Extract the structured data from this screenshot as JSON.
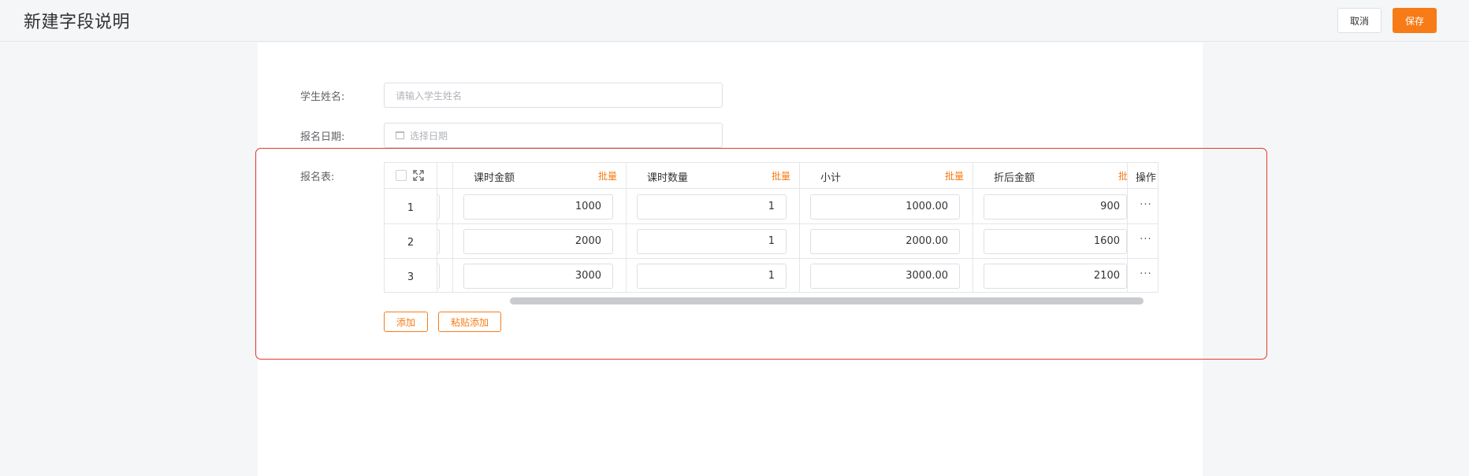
{
  "header": {
    "title": "新建字段说明",
    "cancel_label": "取消",
    "save_label": "保存"
  },
  "form": {
    "student_name": {
      "label": "学生姓名:",
      "placeholder": "请输入学生姓名",
      "value": ""
    },
    "enroll_date": {
      "label": "报名日期:",
      "placeholder": "选择日期",
      "value": ""
    },
    "enroll_table": {
      "label": "报名表:",
      "batch_label": "批量",
      "columns": [
        "课时金额",
        "课时数量",
        "小计",
        "折后金额"
      ],
      "action_header": "操作",
      "rows": [
        {
          "index": "1",
          "amount": "1000",
          "quantity": "1",
          "subtotal": "1000.00",
          "discount": "900",
          "action": "···"
        },
        {
          "index": "2",
          "amount": "2000",
          "quantity": "1",
          "subtotal": "2000.00",
          "discount": "1600",
          "action": "···"
        },
        {
          "index": "3",
          "amount": "3000",
          "quantity": "1",
          "subtotal": "3000.00",
          "discount": "2100",
          "action": "···"
        }
      ]
    },
    "add_label": "添加",
    "paste_add_label": "粘贴添加"
  },
  "colors": {
    "accent": "#f77b16",
    "highlight": "#e23a2e"
  },
  "icons": [
    "calendar-icon",
    "expand-icon",
    "more-icon"
  ]
}
